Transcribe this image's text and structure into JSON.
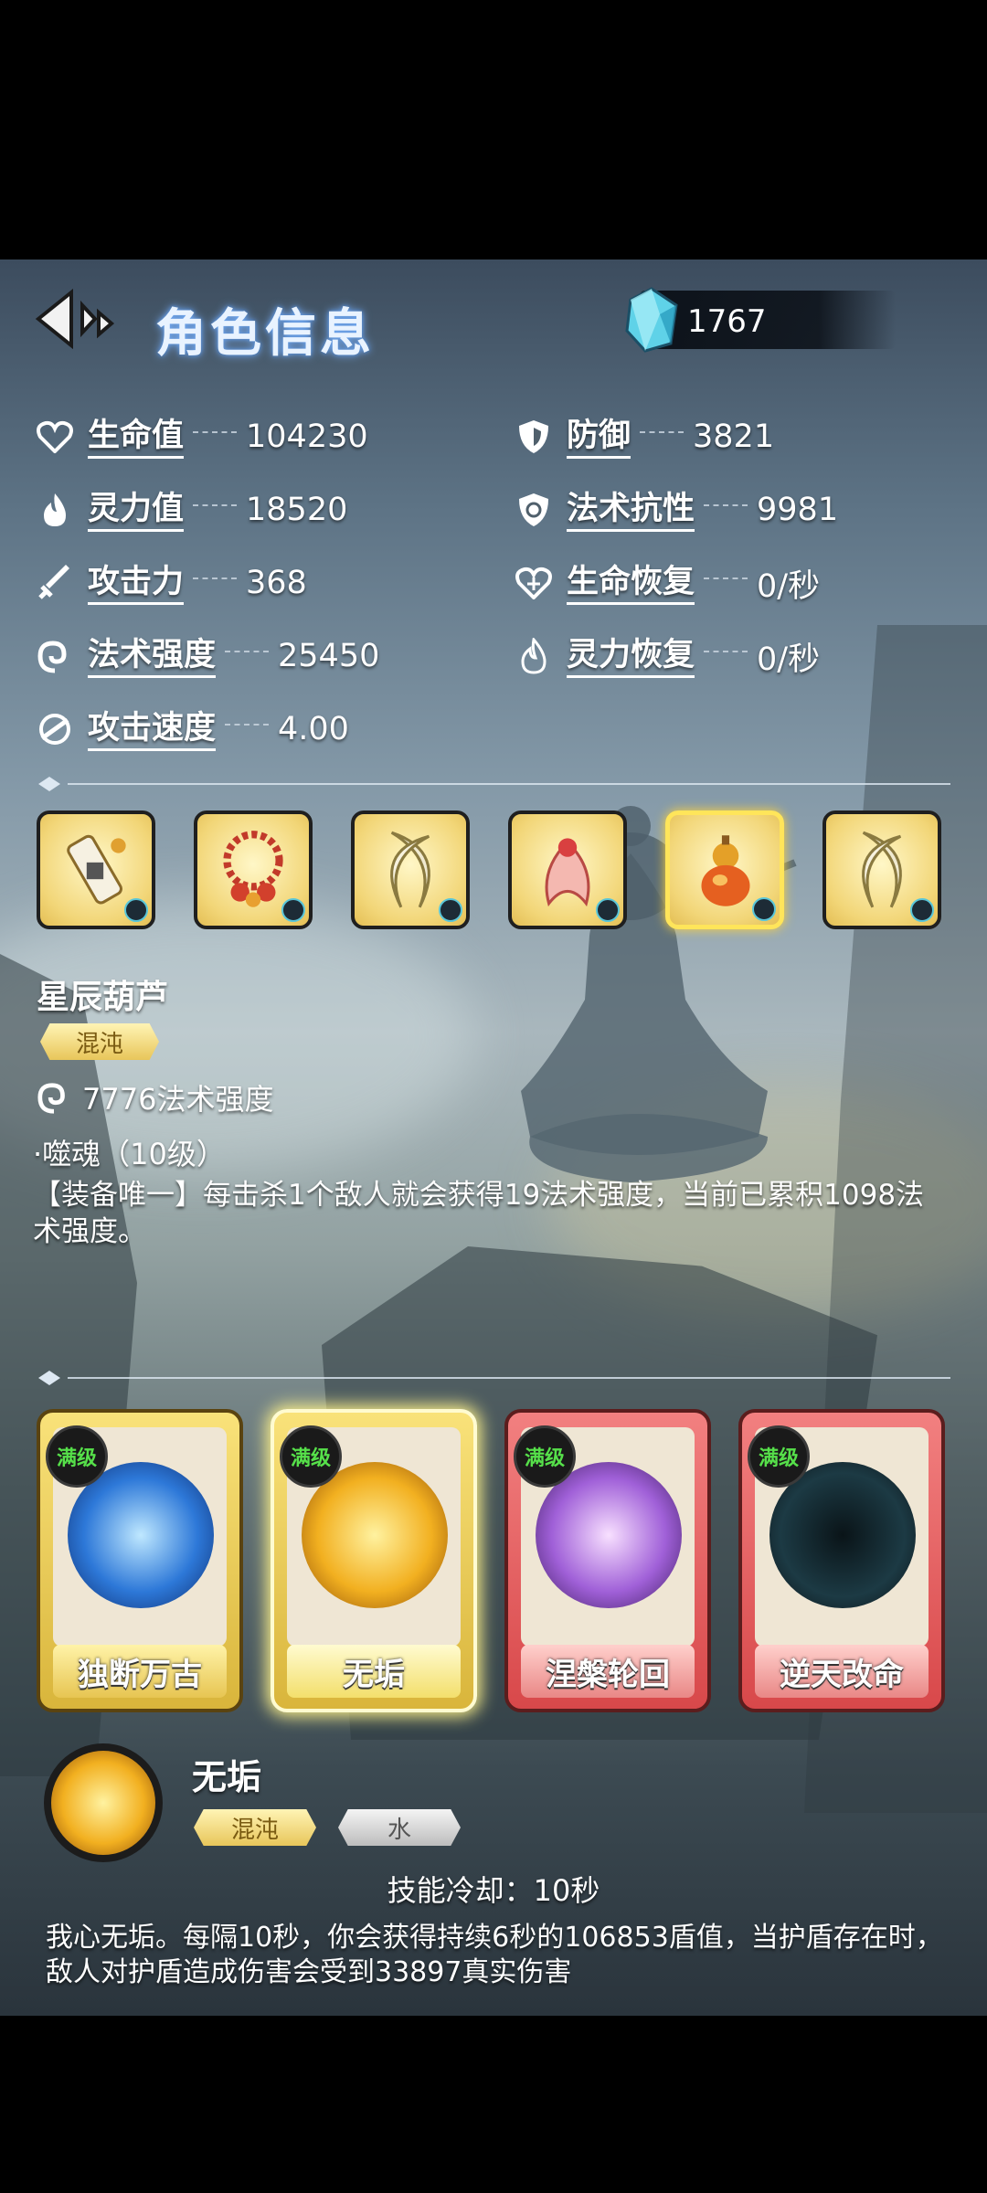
{
  "header": {
    "title": "角色信息",
    "currency_icon": "crystal-gem-icon",
    "currency_count": "1767"
  },
  "stats": {
    "left": [
      {
        "icon": "heart-icon",
        "label": "生命值",
        "value": "104230"
      },
      {
        "icon": "flame-icon",
        "label": "灵力值",
        "value": "18520"
      },
      {
        "icon": "sword-icon",
        "label": "攻击力",
        "value": "368"
      },
      {
        "icon": "swirl-icon",
        "label": "法术强度",
        "value": "25450"
      },
      {
        "icon": "speed-icon",
        "label": "攻击速度",
        "value": "4.00"
      }
    ],
    "right": [
      {
        "icon": "shield-icon",
        "label": "防御",
        "value": "3821"
      },
      {
        "icon": "magic-shield-icon",
        "label": "法术抗性",
        "value": "9981"
      },
      {
        "icon": "heart-regen-icon",
        "label": "生命恢复",
        "value": "0/秒"
      },
      {
        "icon": "flame-regen-icon",
        "label": "灵力恢复",
        "value": "0/秒"
      }
    ]
  },
  "equipment": {
    "selected_index": 4,
    "items": [
      {
        "icon": "scroll-weapon-icon"
      },
      {
        "icon": "bead-necklace-icon"
      },
      {
        "icon": "crescent-blade-icon"
      },
      {
        "icon": "ribbon-ornament-icon"
      },
      {
        "icon": "gourd-icon"
      },
      {
        "icon": "crescent-blade-icon"
      }
    ],
    "selected_item": {
      "name": "星辰葫芦",
      "element_tag": "混沌",
      "power": "7776法术强度",
      "skill": "·噬魂（10级）",
      "description": "【装备唯一】每击杀1个敌人就会获得19法术强度，当前已累积1098法术强度。"
    }
  },
  "skills": {
    "selected_index": 1,
    "cards": [
      {
        "name": "独断万古",
        "level": "满级",
        "frame": "gold",
        "icon": "shadow-warrior-icon"
      },
      {
        "name": "无垢",
        "level": "满级",
        "frame": "gold",
        "icon": "golden-shield-icon"
      },
      {
        "name": "涅槃轮回",
        "level": "满级",
        "frame": "red",
        "icon": "phoenix-spirit-icon"
      },
      {
        "name": "逆天改命",
        "level": "满级",
        "frame": "red",
        "icon": "hooded-figure-icon"
      }
    ],
    "selected_skill": {
      "name": "无垢",
      "tags": [
        "混沌",
        "水"
      ],
      "cooldown": "技能冷却：10秒",
      "description": "我心无垢。每隔10秒，你会获得持续6秒的106853盾值，当护盾存在时，敌人对护盾造成伤害会受到33897真实伤害"
    }
  },
  "colors": {
    "accent_gold": "#f2d678",
    "accent_red": "#d8484a",
    "level_green": "#56e04a"
  }
}
